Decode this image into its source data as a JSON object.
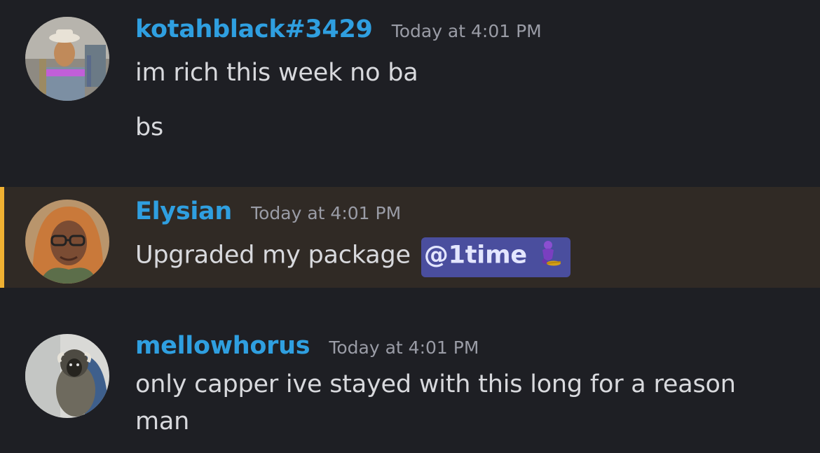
{
  "messages": [
    {
      "username": "kotahblack#3429",
      "timestamp": "Today at 4:01 PM",
      "lines": [
        "im rich this week no ba",
        "bs"
      ],
      "avatar_icon": "user-avatar-hat-man",
      "highlighted": false
    },
    {
      "username": "Elysian",
      "timestamp": "Today at 4:01 PM",
      "text": "Upgraded my package",
      "mention": "@1time",
      "mention_emoji": "genie-emoji",
      "avatar_icon": "user-avatar-woman-glasses",
      "highlighted": true
    },
    {
      "username": "mellowhorus",
      "timestamp": "Today at 4:01 PM",
      "lines": [
        "only capper ive stayed with this long for a reason",
        "man"
      ],
      "avatar_icon": "user-avatar-monkey",
      "highlighted": false
    }
  ],
  "colors": {
    "background": "#1e1f24",
    "highlight_background": "#302a25",
    "highlight_bar": "#f0b132",
    "username": "#2f9fe0",
    "mention_background": "#4a4e9e"
  }
}
